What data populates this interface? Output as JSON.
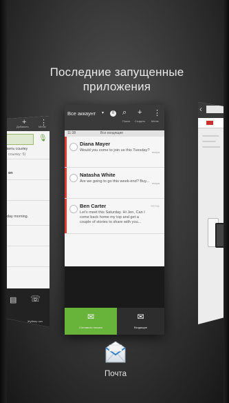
{
  "header": {
    "title_line1": "Последние запущенные",
    "title_line2": "приложения"
  },
  "left_card": {
    "toolbar": [
      {
        "icon": "plus-icon",
        "label": "Добавить"
      },
      {
        "icon": "menu-icon",
        "label": "Меню"
      }
    ],
    "texts": [
      "вить ссылку",
      "ссылку: 5)",
      "on",
      "day morning."
    ],
    "bottom_label": "Жуйпер окн"
  },
  "center_card": {
    "account_label": "Все аккаунт",
    "badge_count": "0",
    "header_icons": [
      {
        "icon": "search-icon",
        "label": "Поиск"
      },
      {
        "icon": "plus-icon",
        "label": "Создать"
      },
      {
        "icon": "menu-icon",
        "label": "Меню"
      }
    ],
    "subbar_time": "11:38",
    "subbar_caption": "Все входящие",
    "emails": [
      {
        "from": "Diana Mayer",
        "preview": "Would you come to join us this Tuesday?",
        "date": "вчера"
      },
      {
        "from": "Natasha White",
        "preview": "Are we going to go this week-end? Buy...",
        "date": "вчера"
      },
      {
        "from": "Ben Carter",
        "preview": "Let's meet this Saturday. Hi Jen, Can I come back home my top and get a couple of stories to share with you...",
        "date": "7/27/11"
      }
    ],
    "footer": [
      {
        "icon": "compose-icon",
        "label": "Составить письмо"
      },
      {
        "icon": "inbox-icon",
        "label": "Входящие"
      }
    ]
  },
  "app_label": "Почта",
  "colors": {
    "accent_green": "#68b33a",
    "unread_red": "#e23a2e"
  }
}
